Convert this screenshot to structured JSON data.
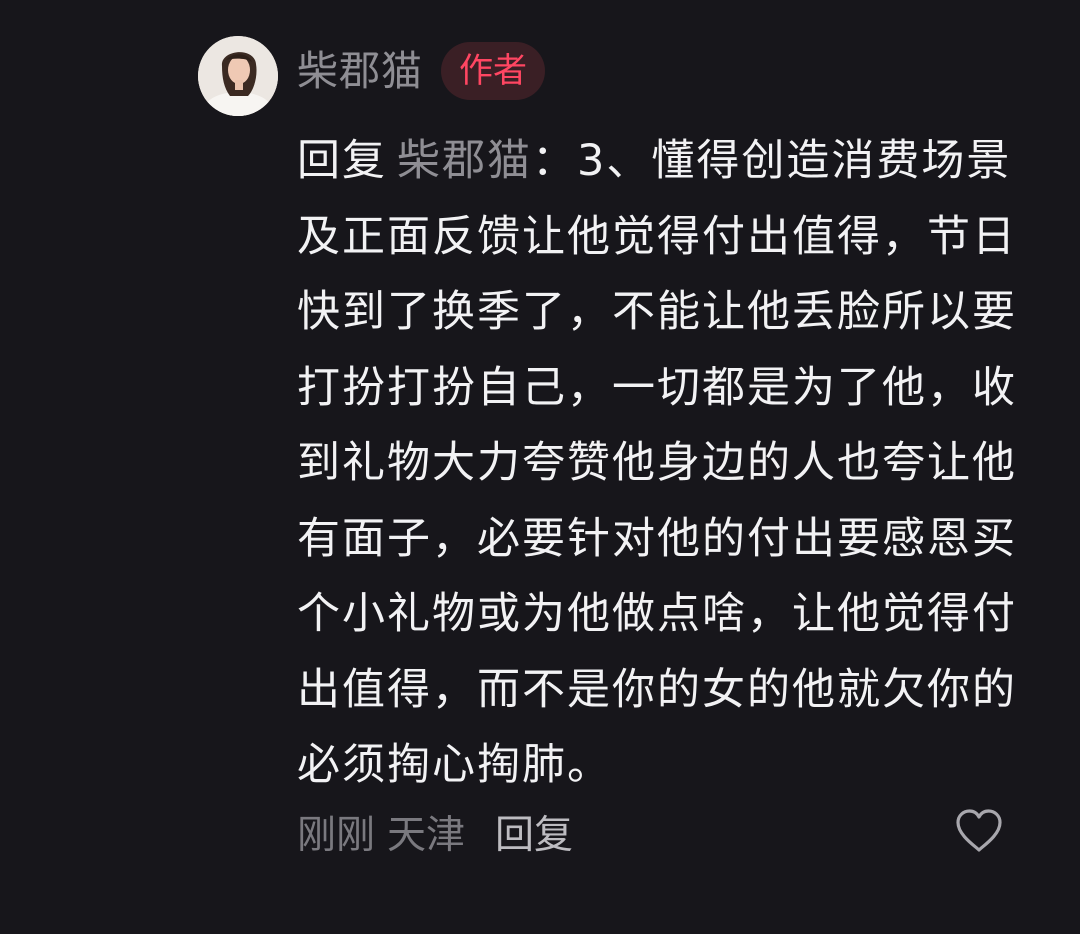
{
  "comment": {
    "author": {
      "name": "柴郡猫",
      "badge": "作者"
    },
    "reply_prefix": "回复",
    "reply_target": "柴郡猫",
    "content": "：3、懂得创造消费场景及正面反馈让他觉得付出值得，节日快到了换季了，不能让他丢脸所以要打扮打扮自己，一切都是为了他，收到礼物大力夸赞他身边的人也夸让他有面子，必要针对他的付出要感恩买个小礼物或为他做点啥，让他觉得付出值得，而不是你的女的他就欠你的必须掏心掏肺。",
    "meta": {
      "time": "刚刚",
      "location": "天津",
      "reply_label": "回复"
    },
    "icons": {
      "like": "heart-icon",
      "avatar": "avatar"
    },
    "colors": {
      "background": "#17161b",
      "text": "#f2f2f4",
      "muted": "#8f8e94",
      "badge_text": "#ff4662",
      "badge_bg": "#3a1f25"
    }
  }
}
